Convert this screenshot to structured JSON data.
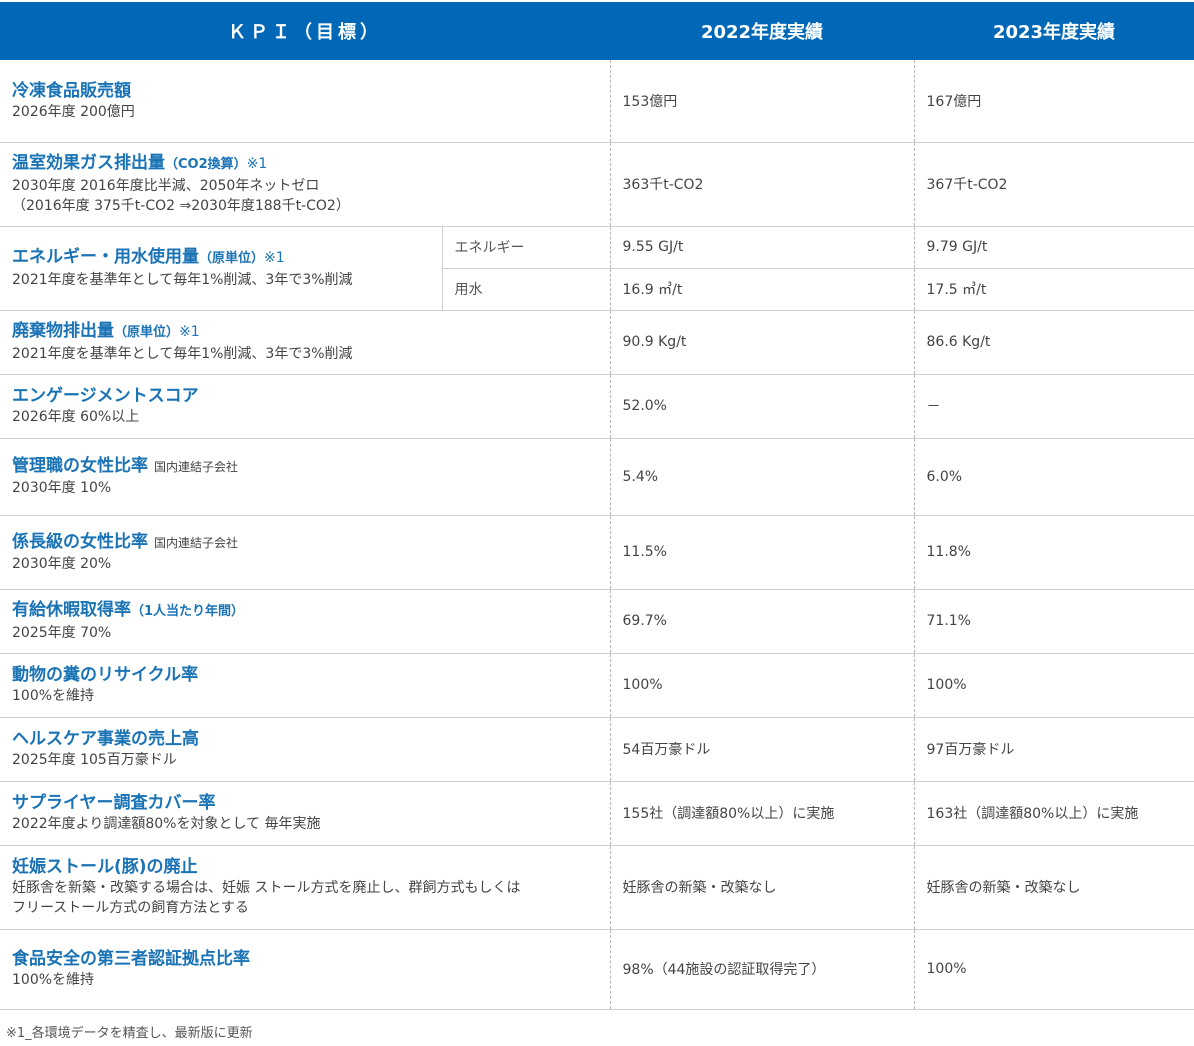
{
  "header": {
    "kpi": "ＫＰＩ（目標）",
    "y2022": "2022年度実績",
    "y2023": "2023年度実績"
  },
  "rows": [
    {
      "title": "冷凍食品販売額",
      "target": "2026年度 200億円",
      "v2022": "153億円",
      "v2023": "167億円"
    },
    {
      "title": "温室効果ガス排出量",
      "title_small": "（CO2換算）",
      "note": "※1",
      "target": "2030年度 2016年度比半減、2050年ネットゼロ",
      "target2": "（2016年度 375千t-CO2 ⇒2030年度188千t-CO2）",
      "v2022": "363千t-CO2",
      "v2023": "367千t-CO2"
    },
    {
      "title": "エネルギー・用水使用量",
      "title_small": "（原単位）",
      "note": "※1",
      "target": "2021年度を基準年として毎年1%削減、3年で3%削減",
      "sub": [
        {
          "label": "エネルギー",
          "v2022": "9.55 GJ/t",
          "v2023": "9.79 GJ/t"
        },
        {
          "label": "用水",
          "v2022": "16.9 ㎥/t",
          "v2023": "17.5 ㎥/t"
        }
      ]
    },
    {
      "title": "廃棄物排出量",
      "title_small": "（原単位）",
      "note": "※1",
      "target": "2021年度を基準年として毎年1%削減、3年で3%削減",
      "v2022": "90.9 Kg/t",
      "v2023": "86.6 Kg/t"
    },
    {
      "title": "エンゲージメントスコア",
      "target": "2026年度 60%以上",
      "v2022": "52.0%",
      "v2023": "－"
    },
    {
      "title": "管理職の女性比率",
      "scope": "国内連結子会社",
      "target": "2030年度 10%",
      "v2022": "5.4%",
      "v2023": "6.0%"
    },
    {
      "title": "係長級の女性比率",
      "scope": "国内連結子会社",
      "target": "2030年度 20%",
      "v2022": "11.5%",
      "v2023": "11.8%"
    },
    {
      "title": "有給休暇取得率",
      "title_small": "（1人当たり年間）",
      "target": "2025年度 70%",
      "v2022": "69.7%",
      "v2023": "71.1%"
    },
    {
      "title": "動物の糞のリサイクル率",
      "target": "100%を維持",
      "v2022": "100%",
      "v2023": "100%"
    },
    {
      "title": "ヘルスケア事業の売上高",
      "target": "2025年度 105百万豪ドル",
      "v2022": "54百万豪ドル",
      "v2023": "97百万豪ドル"
    },
    {
      "title": "サプライヤー調査カバー率",
      "target": "2022年度より調達額80%を対象として 毎年実施",
      "v2022": "155社（調達額80%以上）に実施",
      "v2023": "163社（調達額80%以上）に実施"
    },
    {
      "title": "妊娠ストール(豚)の廃止",
      "target": "妊豚舎を新築・改築する場合は、妊娠 ストール方式を廃止し、群飼方式もしくは",
      "target2": "フリーストール方式の飼育方法とする",
      "v2022": "妊豚舎の新築・改築なし",
      "v2023": "妊豚舎の新築・改築なし"
    },
    {
      "title": "食品安全の第三者認証拠点比率",
      "target": "100%を維持",
      "v2022": "98%（44施設の認証取得完了）",
      "v2023": "100%"
    }
  ],
  "footnote": "※1_各環境データを精査し、最新版に更新"
}
